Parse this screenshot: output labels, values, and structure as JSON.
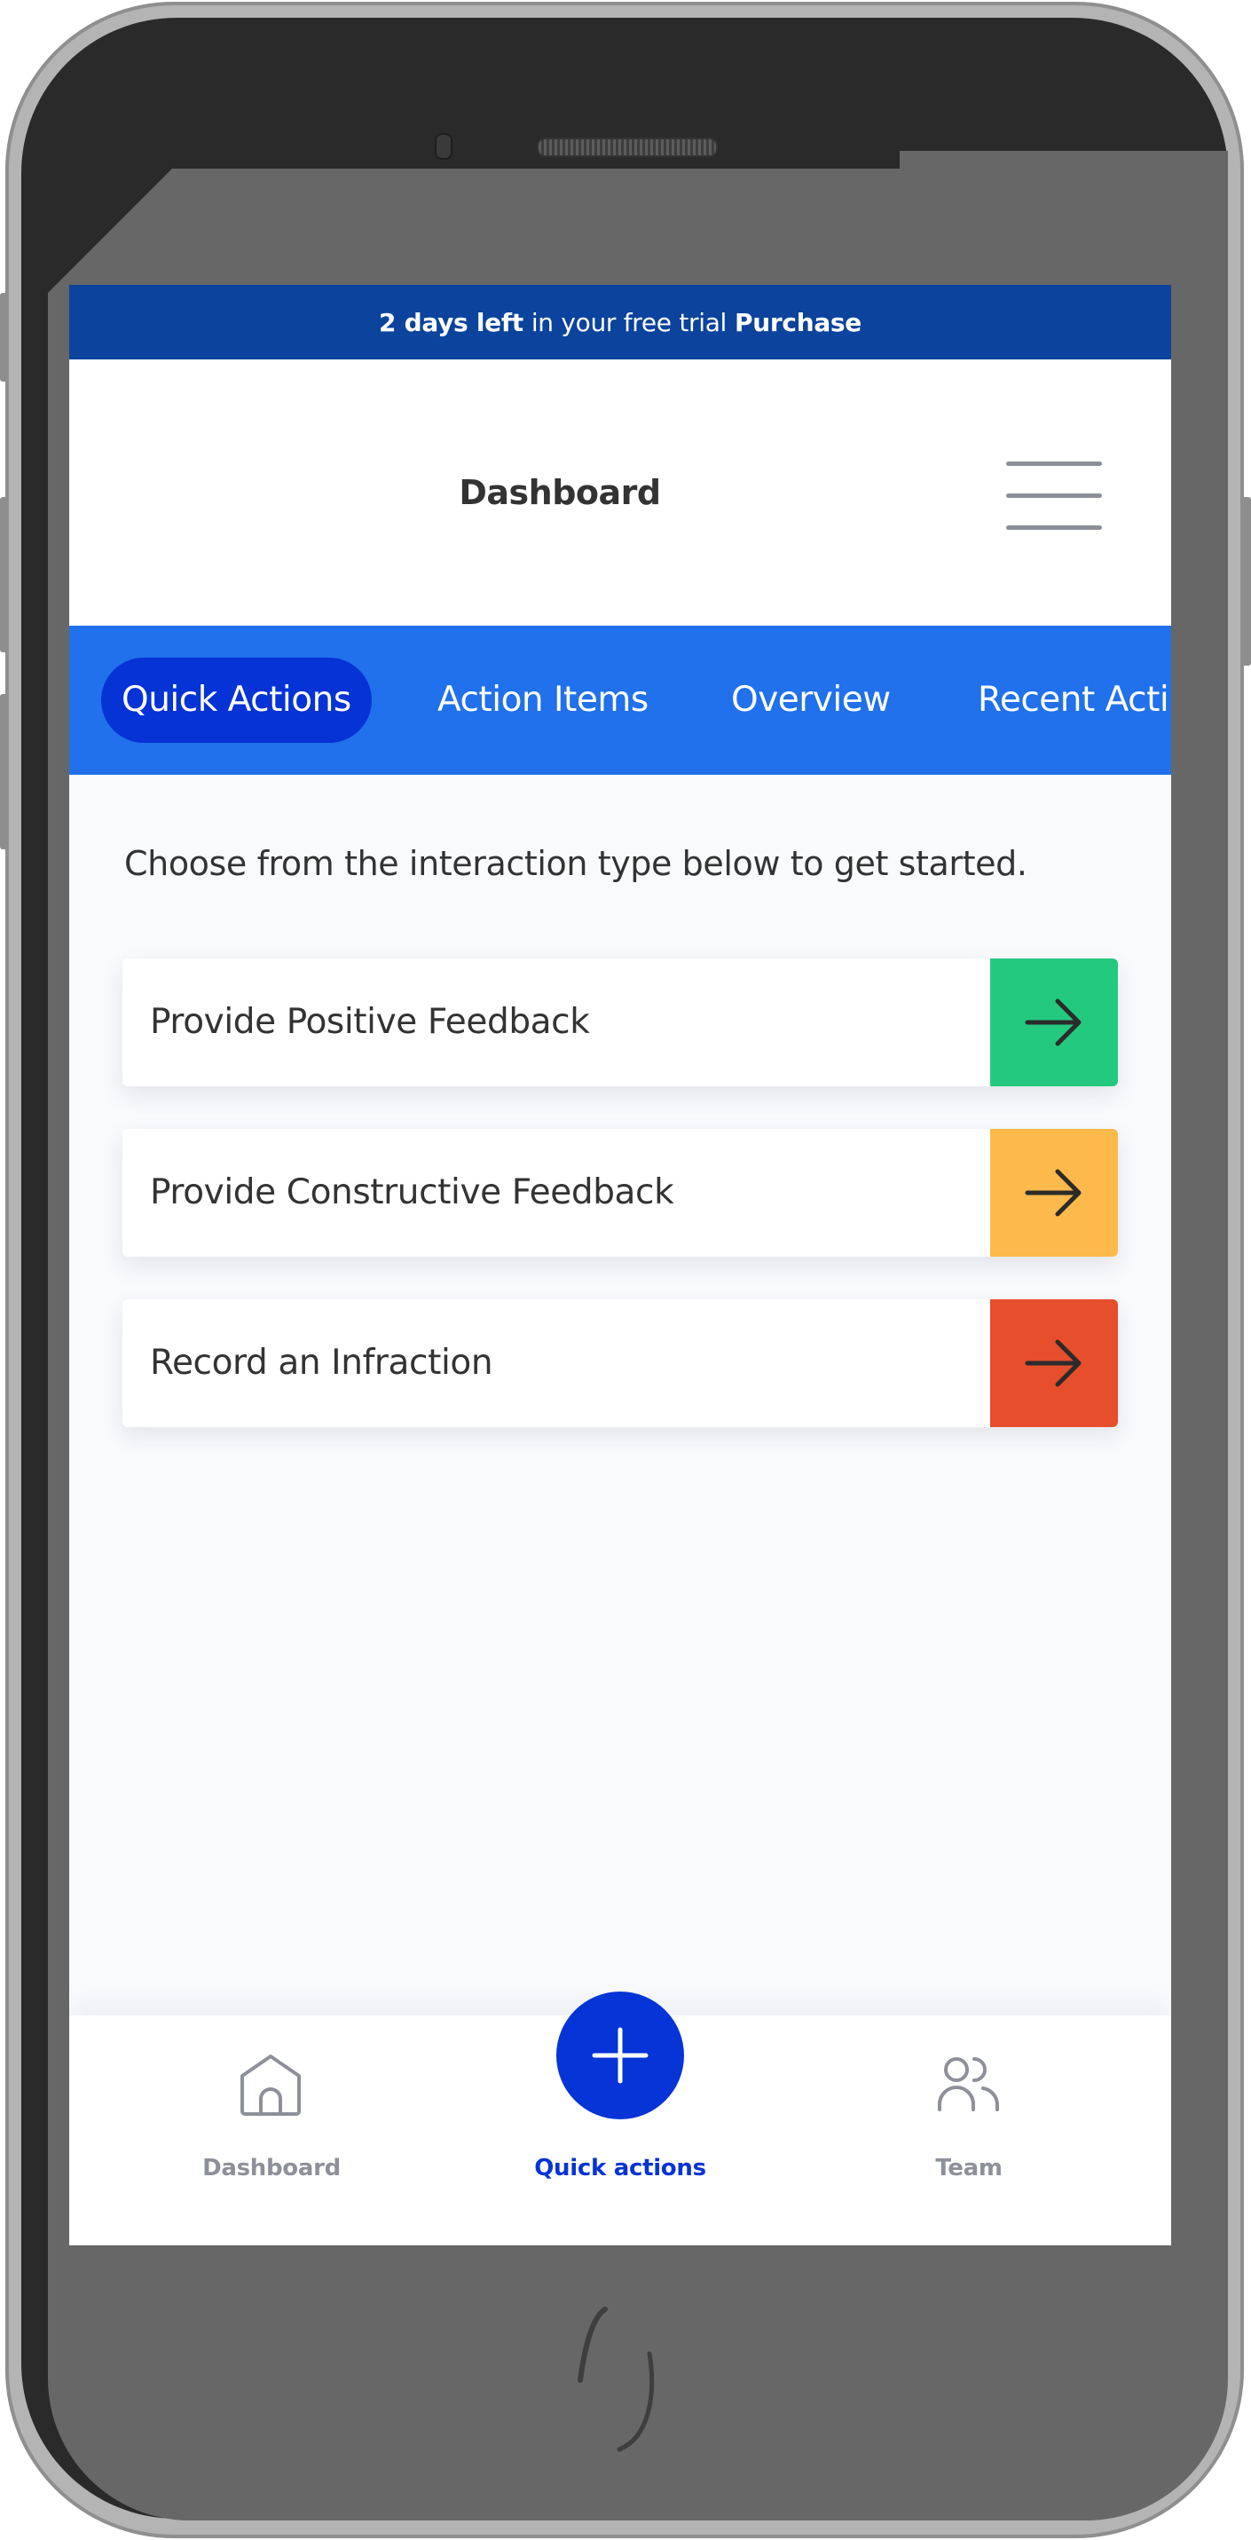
{
  "trial_banner": {
    "days_left": "2 days left",
    "middle_text": "in your free trial",
    "purchase_link": "Purchase",
    "background_color": "#0c439c"
  },
  "header": {
    "title": "Dashboard",
    "menu_icon": "hamburger-menu-icon"
  },
  "tabs": {
    "active_index": 0,
    "items": [
      {
        "label": "Quick Actions",
        "active": true
      },
      {
        "label": "Action Items",
        "active": false
      },
      {
        "label": "Overview",
        "active": false
      },
      {
        "label": "Recent Acti",
        "active": false
      }
    ],
    "bar_color": "#2170ec",
    "active_color": "#0633d5"
  },
  "quick_actions": {
    "intro": "Choose from the interaction type below to get started.",
    "cards": [
      {
        "label": "Provide Positive Feedback",
        "icon": "arrow-right-icon",
        "color": "#24c980"
      },
      {
        "label": "Provide Constructive Feedback",
        "icon": "arrow-right-icon",
        "color": "#fdb94b"
      },
      {
        "label": "Record an Infraction",
        "icon": "arrow-right-icon",
        "color": "#e64e2c"
      }
    ]
  },
  "bottom_nav": {
    "items": [
      {
        "label": "Dashboard",
        "icon": "home-icon",
        "active": false
      },
      {
        "label": "Quick actions",
        "icon": "plus-icon",
        "active": true
      },
      {
        "label": "Team",
        "icon": "team-icon",
        "active": false
      }
    ],
    "active_color": "#0633d5",
    "inactive_color": "#8e9099"
  }
}
